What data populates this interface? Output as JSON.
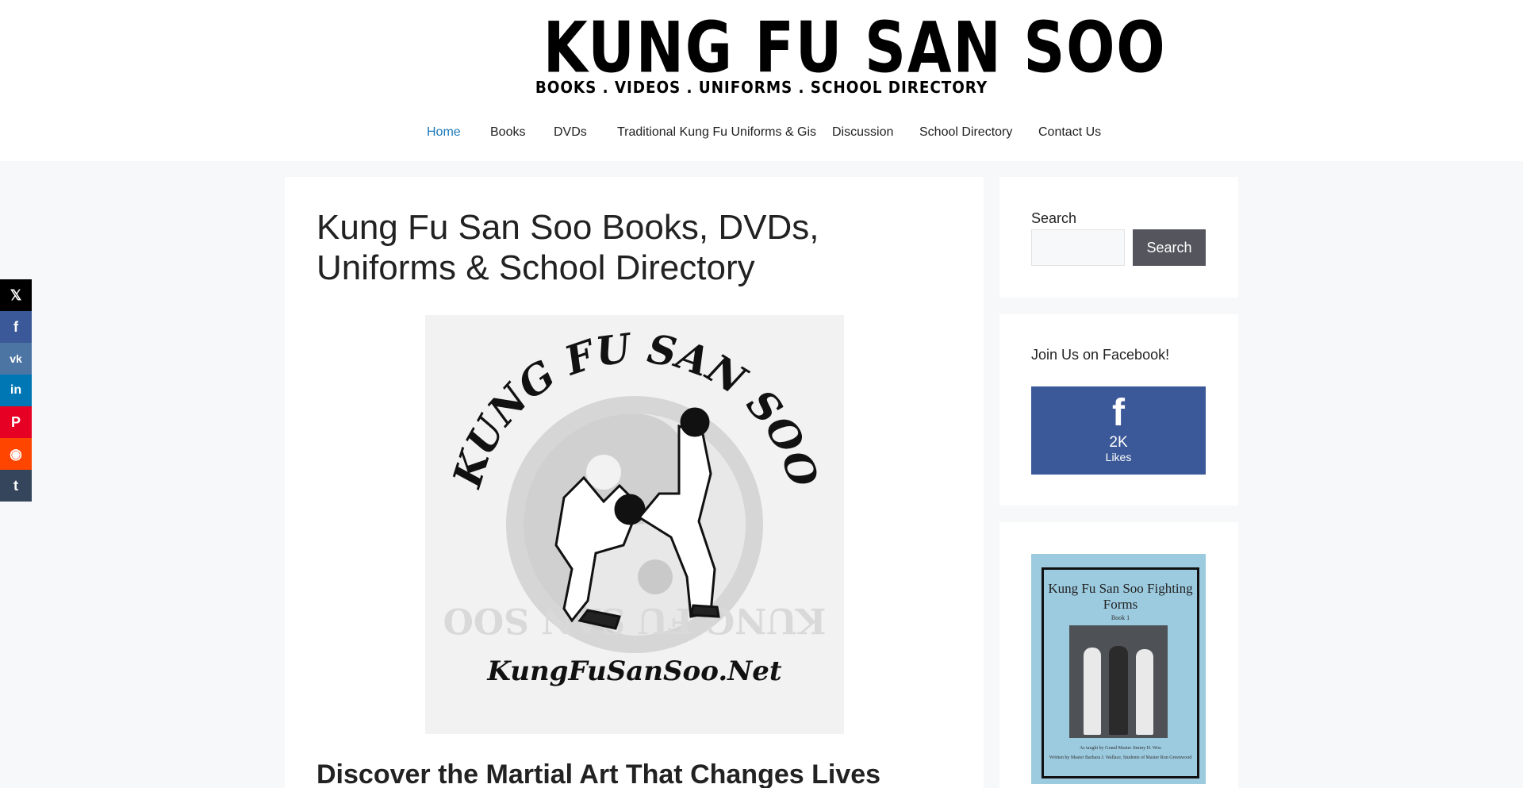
{
  "header": {
    "logo_title": "KUNG FU SAN SOO",
    "logo_subtitle": "BOOKS . VIDEOS . UNIFORMS . SCHOOL DIRECTORY"
  },
  "nav": {
    "items": [
      {
        "label": "Home",
        "active": true
      },
      {
        "label": "Books"
      },
      {
        "label": "DVDs"
      },
      {
        "label": "Traditional Kung Fu Uniforms & Gis"
      },
      {
        "label": "Discussion"
      },
      {
        "label": "School Directory"
      },
      {
        "label": "Contact Us"
      }
    ]
  },
  "main": {
    "title": "Kung Fu San Soo Books, DVDs, Uniforms & School Directory",
    "hero_logo_arc_text": "KUNG FU SAN SOO",
    "hero_logo_url_text": "KungFuSanSoo.Net",
    "section_heading": "Discover the Martial Art That Changes Lives"
  },
  "sidebar": {
    "search": {
      "label": "Search",
      "button_label": "Search",
      "placeholder": ""
    },
    "facebook": {
      "heading": "Join Us on Facebook!",
      "icon": "facebook-f-icon",
      "count": "2K",
      "count_label": "Likes",
      "color": "#3b5998"
    },
    "book": {
      "title": "Kung Fu San Soo Fighting Forms",
      "subtitle": "Book 1",
      "taught_by": "As taught by Grand Master Jimmy H. Woo",
      "written_by": "Written by Master Barbara J. Wallace, Students of Master Ron Greenwood",
      "cover_color": "#9ccbe0"
    }
  },
  "share_bar": [
    {
      "icon": "x-icon",
      "glyph": "𝕏",
      "color": "#000000"
    },
    {
      "icon": "facebook-icon",
      "glyph": "f",
      "color": "#3b5998"
    },
    {
      "icon": "vk-icon",
      "glyph": "vk",
      "color": "#4c75a3"
    },
    {
      "icon": "linkedin-icon",
      "glyph": "in",
      "color": "#0077b5"
    },
    {
      "icon": "pinterest-icon",
      "glyph": "P",
      "color": "#e60023"
    },
    {
      "icon": "reddit-icon",
      "glyph": "◉",
      "color": "#ff4500"
    },
    {
      "icon": "tumblr-icon",
      "glyph": "t",
      "color": "#35465c"
    }
  ],
  "colors": {
    "accent": "#1b78b8",
    "page_bg": "#f7f8f9",
    "search_button": "#55555e"
  }
}
